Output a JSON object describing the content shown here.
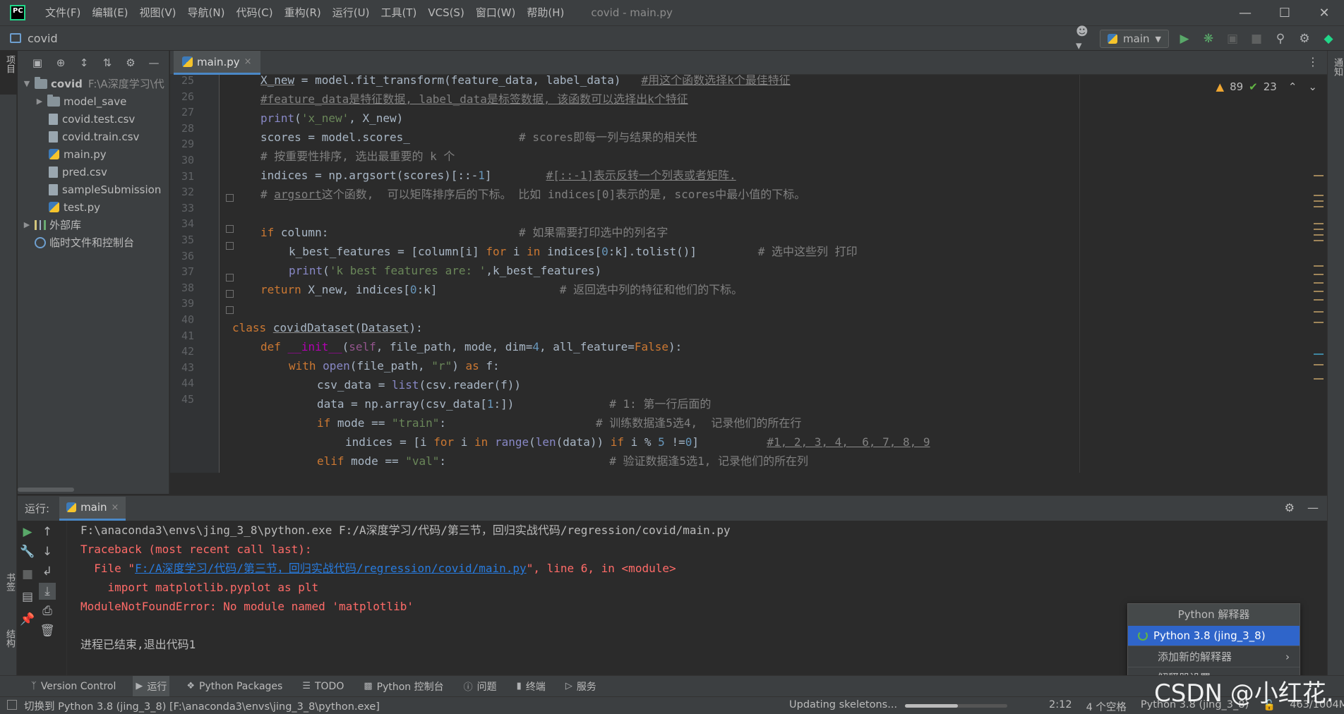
{
  "titlebar": {
    "menu": [
      "文件(F)",
      "编辑(E)",
      "视图(V)",
      "导航(N)",
      "代码(C)",
      "重构(R)",
      "运行(U)",
      "工具(T)",
      "VCS(S)",
      "窗口(W)",
      "帮助(H)"
    ],
    "window_title": "covid - main.py",
    "controls": {
      "minimize": "—",
      "maximize": "☐",
      "close": "✕"
    }
  },
  "navbar": {
    "project": "covid",
    "run_config": "main"
  },
  "left_stripe": {
    "project_label": "项目",
    "bookmarks_label": "书签",
    "structure_label": "结构"
  },
  "right_stripe": {
    "notifications_label": "通知"
  },
  "project_tree": {
    "root": {
      "name": "covid",
      "path": "F:\\A深度学习\\代"
    },
    "children": [
      {
        "name": "model_save",
        "type": "folder"
      },
      {
        "name": "covid.test.csv",
        "type": "file"
      },
      {
        "name": "covid.train.csv",
        "type": "file"
      },
      {
        "name": "main.py",
        "type": "py"
      },
      {
        "name": "pred.csv",
        "type": "file"
      },
      {
        "name": "sampleSubmission",
        "type": "file"
      },
      {
        "name": "test.py",
        "type": "py"
      }
    ],
    "external_libs": "外部库",
    "scratches": "临时文件和控制台"
  },
  "editor": {
    "tab": "main.py",
    "tab_close": "×",
    "inspections": {
      "warnings": "89",
      "ok": "23"
    },
    "line_numbers": [
      "25",
      "26",
      "27",
      "28",
      "29",
      "30",
      "31",
      "32",
      "33",
      "34",
      "35",
      "36",
      "37",
      "38",
      "39",
      "40",
      "41",
      "42",
      "43",
      "44",
      "45"
    ]
  },
  "run_panel": {
    "label": "运行:",
    "tab": "main",
    "console": {
      "cmd": "F:\\anaconda3\\envs\\jing_3_8\\python.exe F:/A深度学习/代码/第三节，回归实战代码/regression/covid/main.py",
      "traceback": "Traceback (most recent call last):",
      "file_prefix": "  File \"",
      "file_link": "F:/A深度学习/代码/第三节，回归实战代码/regression/covid/main.py",
      "file_suffix": "\", line 6, in <module>",
      "import_line": "    import matplotlib.pyplot as plt",
      "error": "ModuleNotFoundError: No module named 'matplotlib'",
      "exit": "进程已结束,退出代码1"
    }
  },
  "interpreter_popup": {
    "title": "Python 解释器",
    "current": "Python 3.8 (jing_3_8)",
    "add": "添加新的解释器",
    "settings": "解释器设置..."
  },
  "bottom_tools": [
    "Version Control",
    "运行",
    "Python Packages",
    "TODO",
    "Python 控制台",
    "问题",
    "终端",
    "服务"
  ],
  "statusbar": {
    "message": "切换到 Python 3.8 (jing_3_8) [F:\\anaconda3\\envs\\jing_3_8\\python.exe]",
    "progress_text": "Updating skeletons...",
    "progress": 0.52,
    "position": "2:12",
    "indent": "4 个空格",
    "interpreter": "Python 3.8 (jing_3_8)",
    "memory": "463/1004M"
  },
  "watermark": "CSDN @小红花."
}
